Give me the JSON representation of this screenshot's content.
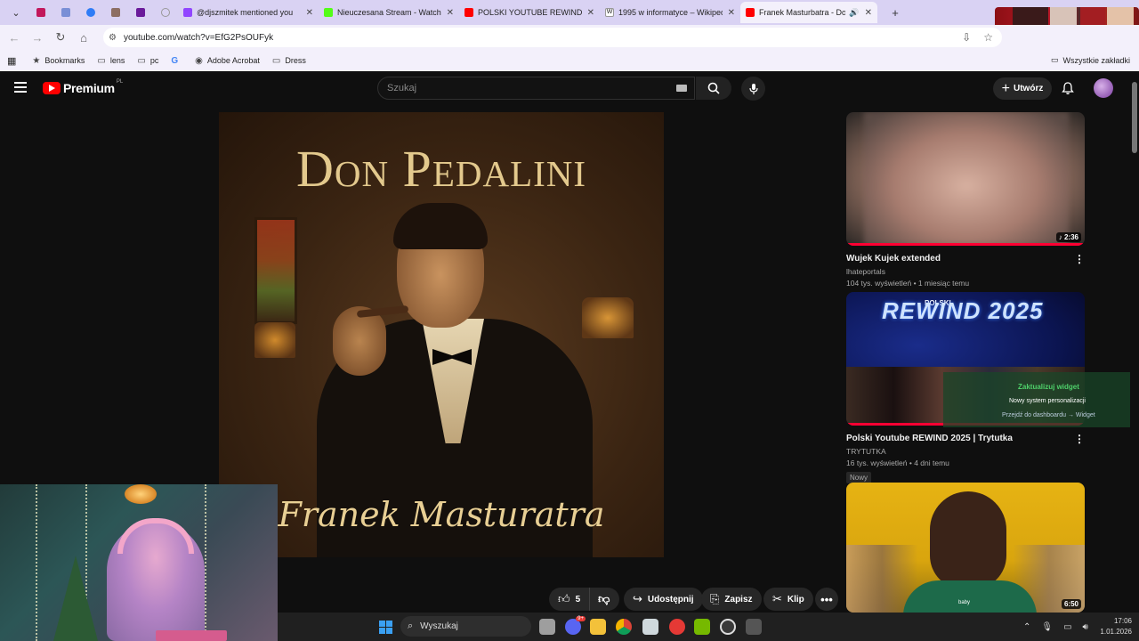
{
  "browser": {
    "tabs": [
      {
        "label": "@djszmitek mentioned you",
        "favicon_color": "#9146ff"
      },
      {
        "label": "Nieuczesana Stream - Watch Li",
        "favicon_color": "#53fc18"
      },
      {
        "label": "POLSKI YOUTUBE REWIND 202",
        "favicon_color": "#ff0000"
      },
      {
        "label": "1995 w informatyce – Wikipedi",
        "favicon_color": "#ffffff"
      },
      {
        "label": "Franek Masturbatra - Don P",
        "favicon_color": "#ff0000",
        "active": true
      }
    ],
    "url": "youtube.com/watch?v=EfG2PsOUFyk",
    "bookmarks": [
      {
        "label": "Bookmarks",
        "icon": "star-icon"
      },
      {
        "label": "lens",
        "icon": "folder-icon"
      },
      {
        "label": "pc",
        "icon": "folder-icon"
      },
      {
        "label": "",
        "icon": "google-icon"
      },
      {
        "label": "Adobe Acrobat",
        "icon": "acrobat-icon"
      },
      {
        "label": "Dress",
        "icon": "folder-icon"
      }
    ],
    "all_bookmarks": "Wszystkie zakładki"
  },
  "youtube": {
    "logo_text": "Premium",
    "logo_region": "PL",
    "search_placeholder": "Szukaj",
    "create_label": "Utwórz",
    "video": {
      "cover_title": "Don Pedalini",
      "cover_subtitle": "Franek Masturatra",
      "likes": "5",
      "share_label": "Udostępnij",
      "save_label": "Zapisz",
      "clip_label": "Klip"
    },
    "recommendations": [
      {
        "title": "Wujek Kujek extended",
        "channel": "lhateportals",
        "meta": "104 tys. wyświetleń • 1 miesiąc temu",
        "duration": "2:36",
        "watched_fraction": 1.0
      },
      {
        "title": "Polski Youtube REWIND 2025 | Trytutka",
        "channel": "TRYTUTKA",
        "meta": "16 tys. wyświetleń • 4 dni temu",
        "badge": "Nowy",
        "duration": "",
        "watched_fraction": 1.0,
        "thumb_text": "REWIND 2025",
        "thumb_small": "POLSKI"
      },
      {
        "title": "",
        "channel": "",
        "meta": "",
        "duration": "6:50",
        "thumb_tag": "baby"
      }
    ]
  },
  "widget": {
    "title": "Zaktualizuj widget",
    "line1": "Nowy system personalizacji",
    "line2": "Przejdź do dashboardu → Widget"
  },
  "taskbar": {
    "search_label": "Wyszukaj",
    "time": "17:06",
    "date": "1.01.2026",
    "discord_badge": "9+"
  },
  "colors": {
    "youtube_red": "#ff0000",
    "chrome_tabbar": "#d9d2f3",
    "chrome_toolbar": "#f3f0fb",
    "yt_background": "#0f0f0f"
  }
}
